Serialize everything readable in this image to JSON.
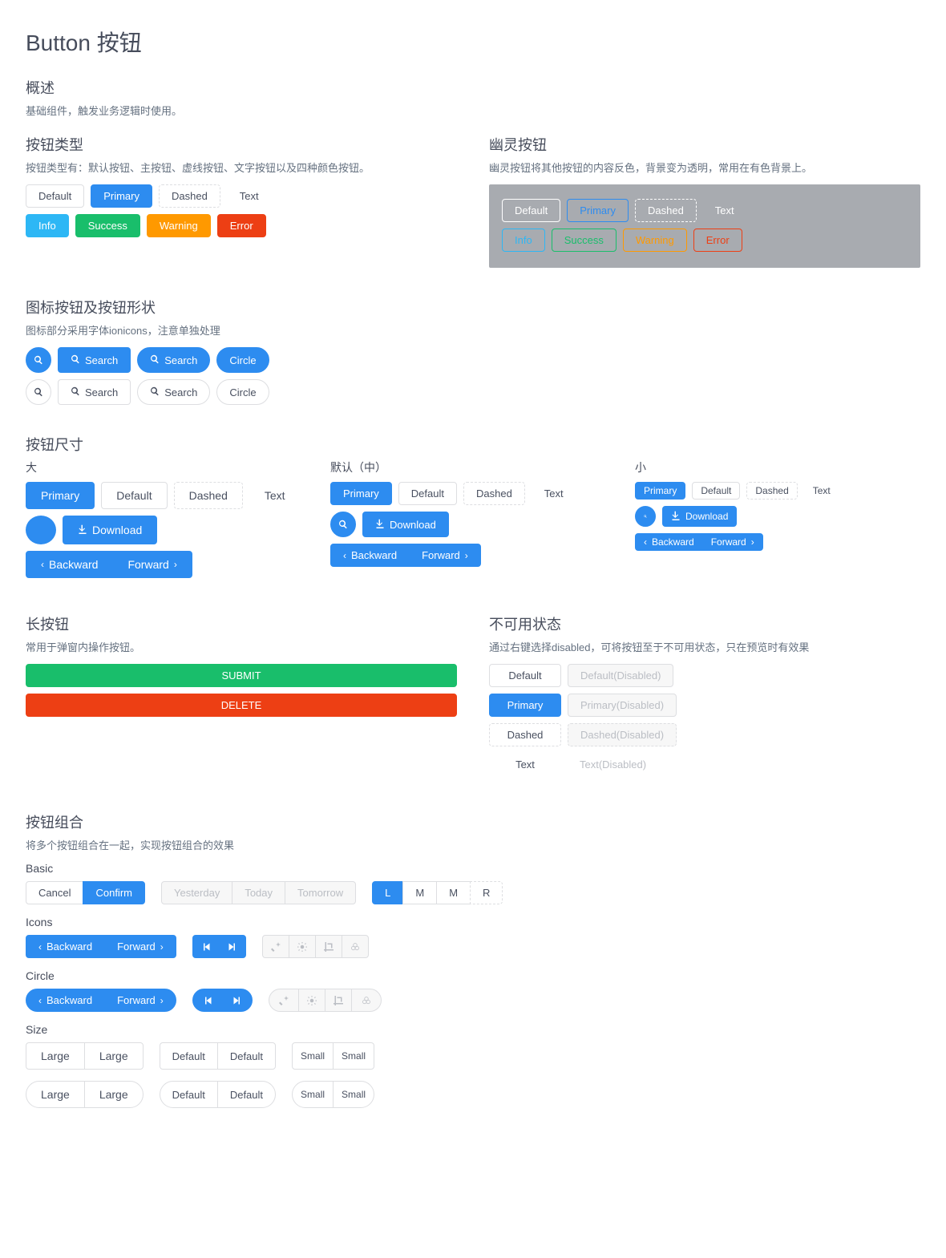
{
  "page": {
    "title": "Button 按钮",
    "overview_h": "概述",
    "overview_desc": "基础组件，触发业务逻辑时使用。"
  },
  "types": {
    "h": "按钮类型",
    "desc": "按钮类型有：默认按钮、主按钮、虚线按钮、文字按钮以及四种颜色按钮。",
    "default": "Default",
    "primary": "Primary",
    "dashed": "Dashed",
    "text": "Text",
    "info": "Info",
    "success": "Success",
    "warning": "Warning",
    "error": "Error"
  },
  "ghost": {
    "h": "幽灵按钮",
    "desc": "幽灵按钮将其他按钮的内容反色，背景变为透明，常用在有色背景上。"
  },
  "icons": {
    "h": "图标按钮及按钮形状",
    "desc": "图标部分采用字体ionicons，注意单独处理",
    "search": "Search",
    "circle": "Circle"
  },
  "sizes": {
    "h": "按钮尺寸",
    "large": "大",
    "default": "默认（中）",
    "small": "小",
    "primary": "Primary",
    "default_btn": "Default",
    "dashed": "Dashed",
    "text": "Text",
    "download": "Download",
    "backward": "Backward",
    "forward": "Forward"
  },
  "long": {
    "h": "长按钮",
    "desc": "常用于弹窗内操作按钮。",
    "submit": "SUBMIT",
    "delete": "DELETE"
  },
  "disabled": {
    "h": "不可用状态",
    "desc": "通过右键选择disabled，可将按钮至于不可用状态，只在预览时有效果",
    "default": "Default",
    "default_d": "Default(Disabled)",
    "primary": "Primary",
    "primary_d": "Primary(Disabled)",
    "dashed": "Dashed",
    "dashed_d": "Dashed(Disabled)",
    "text": "Text",
    "text_d": "Text(Disabled)"
  },
  "groups": {
    "h": "按钮组合",
    "desc": "将多个按钮组合在一起，实现按钮组合的效果",
    "basic": "Basic",
    "icons": "Icons",
    "circle": "Circle",
    "size": "Size",
    "cancel": "Cancel",
    "confirm": "Confirm",
    "yesterday": "Yesterday",
    "today": "Today",
    "tomorrow": "Tomorrow",
    "l": "L",
    "m": "M",
    "r": "R",
    "backward": "Backward",
    "forward": "Forward",
    "large": "Large",
    "default": "Default",
    "small": "Small"
  }
}
